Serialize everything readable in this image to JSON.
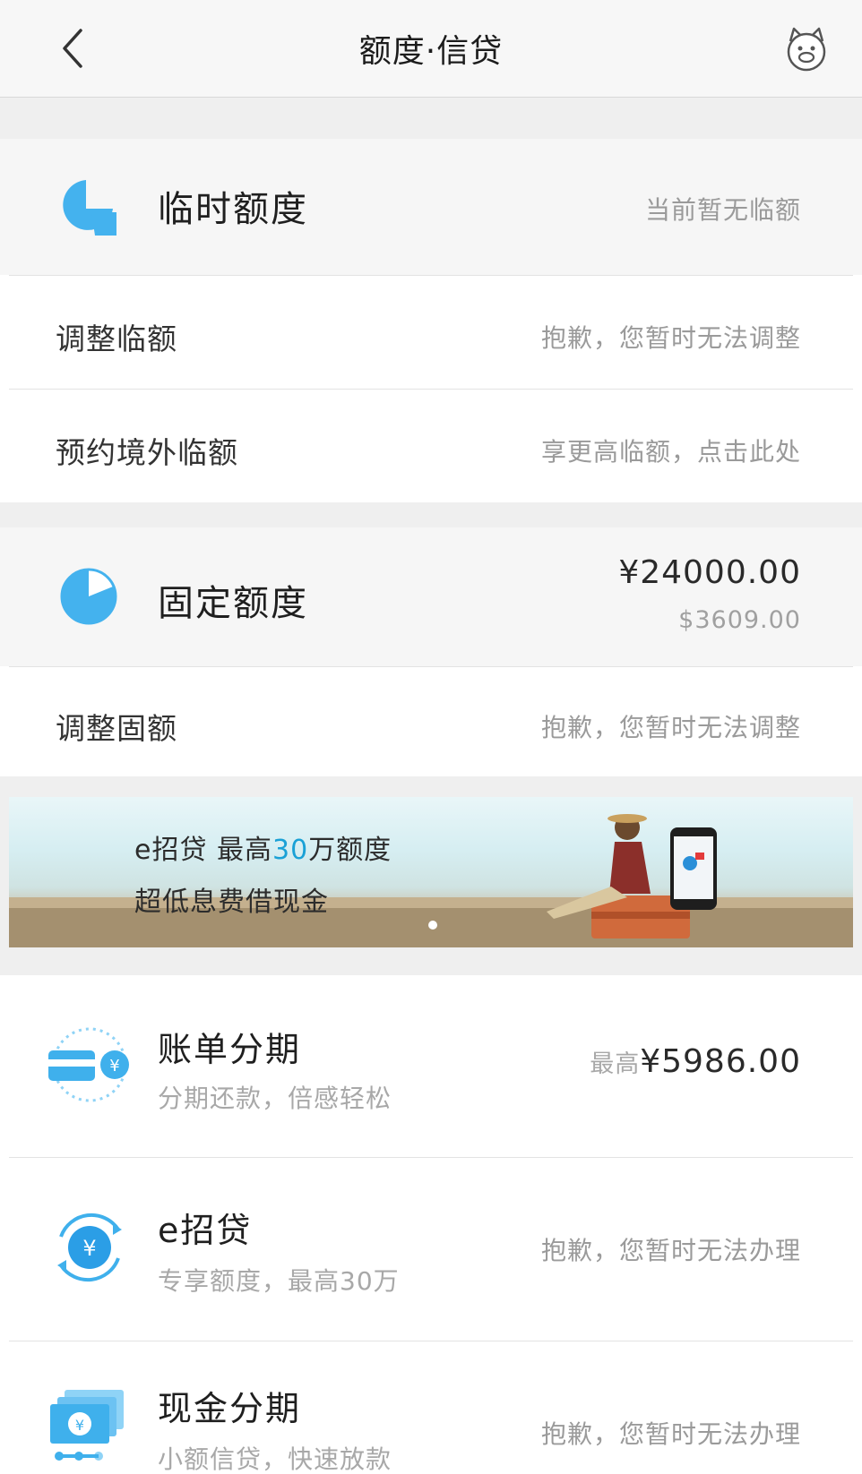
{
  "nav": {
    "title": "额度·信贷"
  },
  "temp_limit": {
    "title": "临时额度",
    "status": "当前暂无临额",
    "rows": [
      {
        "label": "调整临额",
        "value": "抱歉，您暂时无法调整"
      },
      {
        "label": "预约境外临额",
        "value": "享更高临额，点击此处"
      }
    ]
  },
  "fixed_limit": {
    "title": "固定额度",
    "amount_cny": "¥24000.00",
    "amount_usd": "$3609.00",
    "rows": [
      {
        "label": "调整固额",
        "value": "抱歉，您暂时无法调整"
      }
    ]
  },
  "banner": {
    "line1_prefix": "e招贷  最高",
    "line1_accent": "30",
    "line1_suffix": "万额度",
    "line2": "超低息费借现金",
    "accent_color": "#1aa1d6"
  },
  "products": [
    {
      "title": "账单分期",
      "subtitle": "分期还款，倍感轻松",
      "value_prefix": "最高",
      "value": "¥5986.00",
      "icon": "installment-card-icon"
    },
    {
      "title": "e招贷",
      "subtitle": "专享额度，最高30万",
      "value": "抱歉，您暂时无法办理",
      "icon": "yuan-cycle-icon"
    },
    {
      "title": "现金分期",
      "subtitle": "小额信贷，快速放款",
      "value": "抱歉，您暂时无法办理",
      "icon": "cash-stack-icon"
    }
  ],
  "colors": {
    "brand_blue": "#3fb0ec",
    "icon_light_blue": "#8fd3f6"
  }
}
